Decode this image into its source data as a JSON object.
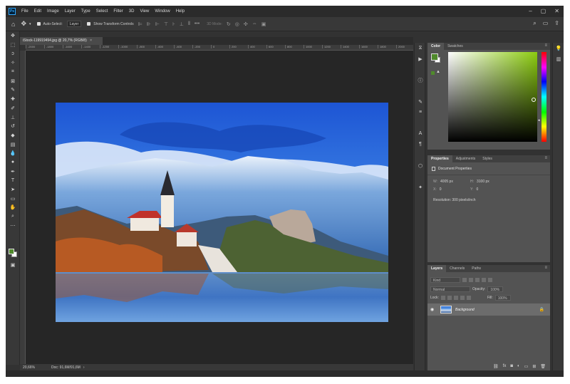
{
  "menu": {
    "logo": "Ps",
    "items": [
      "File",
      "Edit",
      "Image",
      "Layer",
      "Type",
      "Select",
      "Filter",
      "3D",
      "View",
      "Window",
      "Help"
    ]
  },
  "window_controls": [
    "–",
    "▢",
    "✕"
  ],
  "options": {
    "auto_select_label": "Auto-Select:",
    "auto_select_value": "Layer",
    "transform_label": "Show Transform Controls",
    "mode_label": "3D Mode:"
  },
  "document": {
    "tab_title": "iStock-119919494.jpg @ 20,7% (RGB/8)",
    "close": "×",
    "ruler_ticks": [
      "-2000",
      "-1800",
      "-1600",
      "-1400",
      "-1200",
      "-1000",
      "-800",
      "-600",
      "-400",
      "-200",
      "0",
      "200",
      "400",
      "600",
      "800",
      "1000",
      "1200",
      "1400",
      "1600",
      "1800",
      "2000",
      "2200",
      "2400",
      "2600",
      "2800",
      "3000",
      "3200",
      "3400",
      "3600",
      "3800",
      "4000",
      "4200",
      "4400"
    ]
  },
  "status": {
    "zoom": "20,66%",
    "doc_size": "Doc: 91,6M/91,6M"
  },
  "color_panel": {
    "tabs": [
      "Color",
      "Swatches"
    ],
    "foreground": "#4f8a2b",
    "background": "#ffffff"
  },
  "properties_panel": {
    "tabs": [
      "Properties",
      "Adjustments",
      "Styles"
    ],
    "title": "Document Properties",
    "w": "4005 px",
    "h": "3100 px",
    "x": "0",
    "y": "0",
    "resolution": "Resolution: 300 pixels/inch"
  },
  "layers_panel": {
    "tabs": [
      "Layers",
      "Channels",
      "Paths"
    ],
    "kind": "Kind",
    "blend_mode": "Normal",
    "opacity_label": "Opacity:",
    "opacity_value": "100%",
    "lock_label": "Lock:",
    "fill_label": "Fill:",
    "fill_value": "100%",
    "layer_name": "Background"
  }
}
